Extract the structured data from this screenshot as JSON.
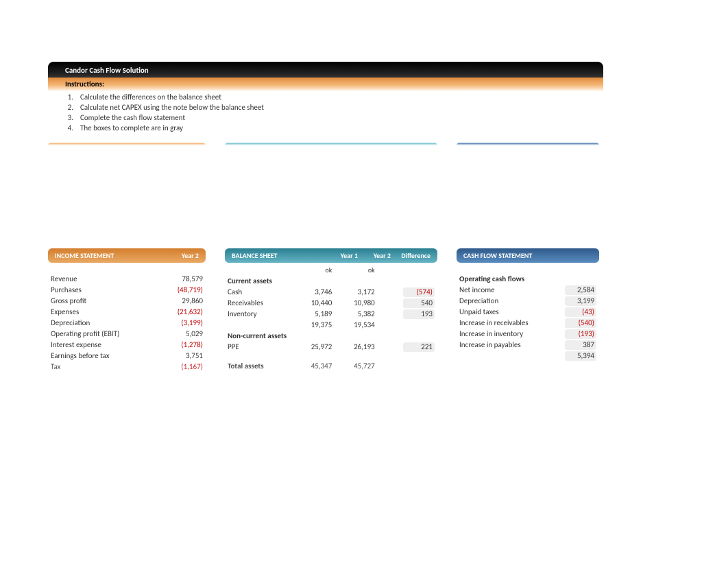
{
  "title": "Candor Cash Flow Solution",
  "instructions_label": "Instructions:",
  "instructions": [
    {
      "n": "1.",
      "t": "Calculate the differences on the balance sheet"
    },
    {
      "n": "2.",
      "t": "Calculate net CAPEX using the note below the balance sheet"
    },
    {
      "n": "3.",
      "t": "Complete the cash flow statement"
    },
    {
      "n": "4.",
      "t": "The boxes to complete are in gray"
    }
  ],
  "is": {
    "title": "INCOME STATEMENT",
    "yr": "Year 2",
    "rows": [
      {
        "l": "Revenue",
        "v": "78,579"
      },
      {
        "l": "Purchases",
        "v": "(48,719)",
        "neg": true
      },
      {
        "l": "Gross profit",
        "v": "29,860"
      },
      {
        "l": "Expenses",
        "v": "(21,632)",
        "neg": true
      },
      {
        "l": "Depreciation",
        "v": "(3,199)",
        "neg": true
      },
      {
        "l": "Operating profit (EBIT)",
        "v": "5,029"
      },
      {
        "l": "Interest expense",
        "v": "(1,278)",
        "neg": true
      },
      {
        "l": "Earnings before tax",
        "v": "3,751"
      },
      {
        "l": "Tax",
        "v": "(1,167)",
        "neg": true
      }
    ]
  },
  "bs": {
    "title": "BALANCE SHEET",
    "y1": "Year 1",
    "y2": "Year 2",
    "diff": "Difference",
    "ok": "ok",
    "sec1": "Current assets",
    "rows1": [
      {
        "l": "Cash",
        "y1": "3,746",
        "y2": "3,172",
        "d": "(574)",
        "dneg": true
      },
      {
        "l": "Receivables",
        "y1": "10,440",
        "y2": "10,980",
        "d": "540"
      },
      {
        "l": "Inventory",
        "y1": "5,189",
        "y2": "5,382",
        "d": "193"
      }
    ],
    "sub1": {
      "y1": "19,375",
      "y2": "19,534"
    },
    "sec2": "Non-current assets",
    "rows2": [
      {
        "l": "PPE",
        "y1": "25,972",
        "y2": "26,193",
        "d": "221"
      }
    ],
    "total": {
      "l": "Total assets",
      "y1": "45,347",
      "y2": "45,727"
    }
  },
  "cf": {
    "title": "CASH FLOW STATEMENT",
    "sec": "Operating cash flows",
    "rows": [
      {
        "l": "Net income",
        "v": "2,584"
      },
      {
        "l": "Depreciation",
        "v": "3,199"
      },
      {
        "l": "Unpaid taxes",
        "v": "(43)",
        "neg": true
      },
      {
        "l": "Increase in receivables",
        "v": "(540)",
        "neg": true
      },
      {
        "l": "Increase in inventory",
        "v": "(193)",
        "neg": true
      },
      {
        "l": "Increase in payables",
        "v": "387"
      }
    ],
    "subtotal": "5,394"
  }
}
